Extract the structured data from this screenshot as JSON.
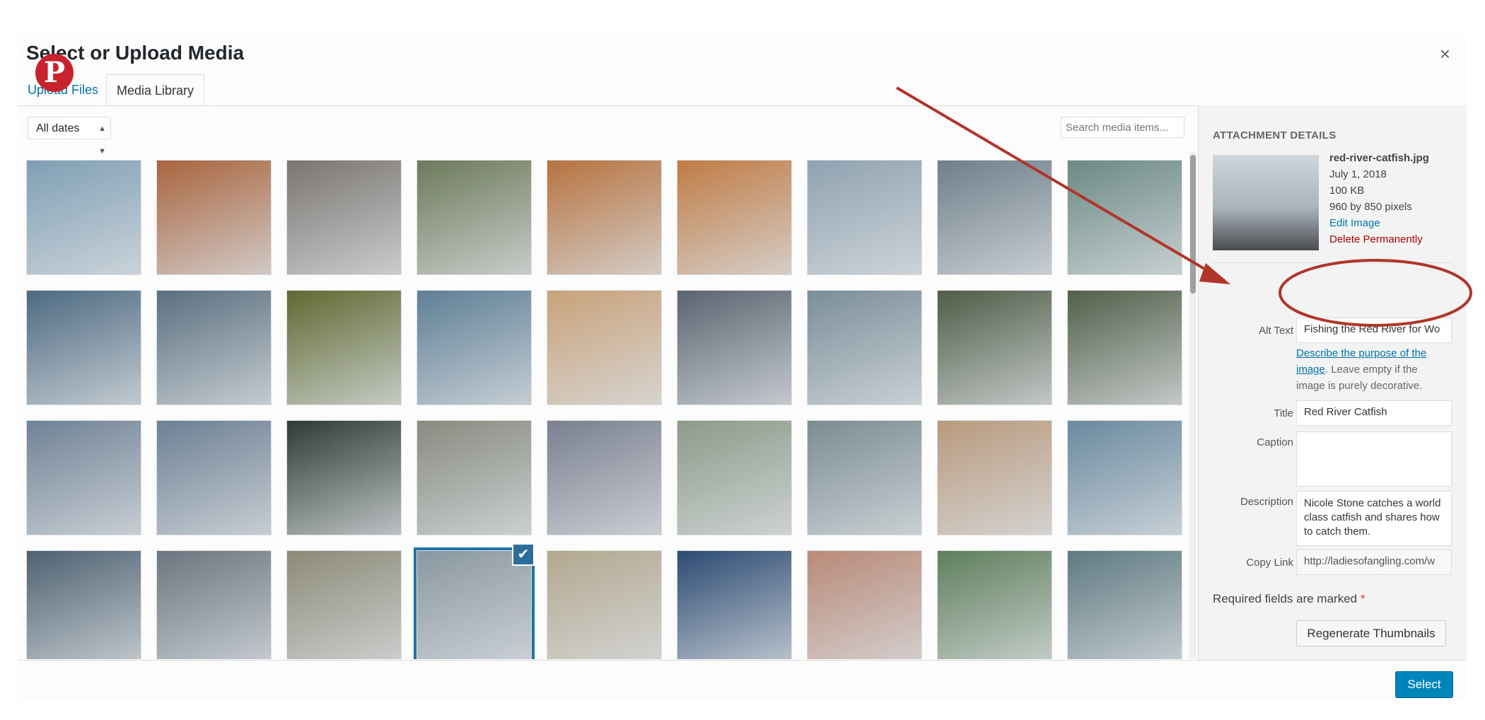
{
  "modal": {
    "title": "Select or Upload Media",
    "close_label": "×",
    "tabs": [
      {
        "label": "Upload Files",
        "active": false
      },
      {
        "label": "Media Library",
        "active": true
      }
    ],
    "filter": {
      "value": "All dates"
    },
    "search": {
      "placeholder": "Search media items..."
    }
  },
  "pinterest_badge": {
    "glyph": "P",
    "color": "#c8232c"
  },
  "grid": {
    "rows": 4,
    "columns": 9,
    "selected_index": 30,
    "thumbs": [
      "#7f9fb5",
      "#a9653f",
      "#7a7570",
      "#6d7a5a",
      "#b7733f",
      "#c07c45",
      "#8fa2b1",
      "#6f7f8a",
      "#6c8a84",
      "#4d6a82",
      "#5a7080",
      "#5f6a32",
      "#5e7f96",
      "#c9a27a",
      "#5a6470",
      "#7a8e9a",
      "#4f5d47",
      "#52604a",
      "#6f8296",
      "#6c8094",
      "#2f3a35",
      "#878b80",
      "#7a8090",
      "#8d9a8a",
      "#7b8d92",
      "#b99a7e",
      "#6a8aa0",
      "#4e6272",
      "#6a7680",
      "#8c8a78",
      "#8a97a0",
      "#b3a890",
      "#2c4b73",
      "#b98a78",
      "#5f7f5c",
      "#5f7a82"
    ],
    "checkmark": "✔"
  },
  "attachment": {
    "heading": "Attachment Details",
    "filename": "red-river-catfish.jpg",
    "date": "July 1, 2018",
    "size": "100 KB",
    "dimensions": "960 by 850 pixels",
    "edit_link": "Edit Image",
    "delete_link": "Delete Permanently",
    "alt_text_label": "Alt Text",
    "alt_text_value": "Fishing the Red River for Wo",
    "help_link": "Describe the purpose of the image",
    "help_rest": ". Leave empty if the image is purely decorative.",
    "title_label": "Title",
    "title_value": "Red River Catfish",
    "caption_label": "Caption",
    "caption_value": "",
    "description_label": "Description",
    "description_value": "Nicole Stone catches a world class catfish and shares how to catch them.",
    "copy_link_label": "Copy Link",
    "copy_link_value": "http://ladiesofangling.com/w",
    "required_text": "Required fields are marked",
    "required_star": "*",
    "regenerate_label": "Regenerate Thumbnails"
  },
  "footer": {
    "select_label": "Select"
  },
  "annotation": {
    "color": "#b0352a"
  }
}
